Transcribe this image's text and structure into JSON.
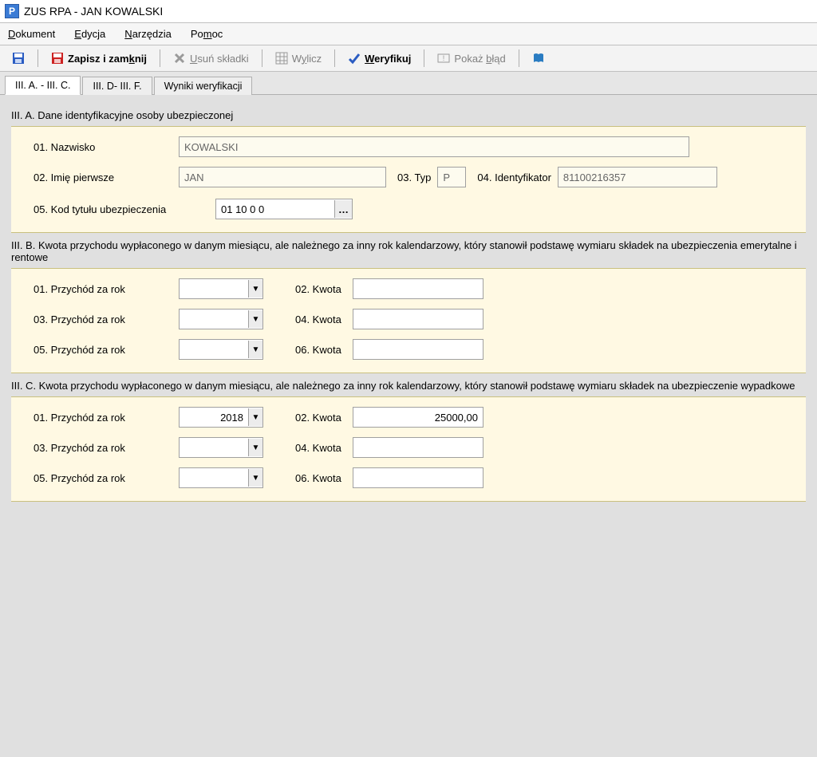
{
  "title": "ZUS RPA - JAN KOWALSKI",
  "menubar": {
    "dokument": "Dokument",
    "edycja": "Edycja",
    "narzedzia": "Narzędzia",
    "pomoc": "Pomoc"
  },
  "toolbar": {
    "save_close": "Zapisz i zamknij",
    "delete": "Usuń składki",
    "calc": "Wylicz",
    "verify": "Weryfikuj",
    "show_error": "Pokaż błąd"
  },
  "tabs": {
    "t1": "III. A. - III. C.",
    "t2": "III. D- III. F.",
    "t3": "Wyniki weryfikacji"
  },
  "sectionA": {
    "heading": "III. A. Dane identyfikacyjne osoby ubezpieczonej",
    "lbl_lastname": "01. Nazwisko",
    "val_lastname": "KOWALSKI",
    "lbl_firstname": "02. Imię pierwsze",
    "val_firstname": "JAN",
    "lbl_type": "03. Typ",
    "val_type": "P",
    "lbl_ident": "04. Identyfikator",
    "val_ident": "81100216357",
    "lbl_code": "05. Kod tytułu ubezpieczenia",
    "val_code": "01 10 0 0"
  },
  "sectionB": {
    "heading": "III. B. Kwota przychodu wypłaconego w danym miesiącu, ale należnego za inny rok kalendarzowy, który  stanowił podstawę wymiaru składek na ubezpieczenia emerytalne i rentowe",
    "lbl_year1": "01. Przychód za  rok",
    "lbl_amt1": "02. Kwota",
    "lbl_year2": "03. Przychód za  rok",
    "lbl_amt2": "04. Kwota",
    "lbl_year3": "05. Przychód za  rok",
    "lbl_amt3": "06. Kwota",
    "val_year1": "",
    "val_amt1": "",
    "val_year2": "",
    "val_amt2": "",
    "val_year3": "",
    "val_amt3": ""
  },
  "sectionC": {
    "heading": "III. C. Kwota przychodu wypłaconego w danym miesiącu, ale należnego za inny rok kalendarzowy, który stanowił podstawę wymiaru składek na ubezpieczenie wypadkowe",
    "lbl_year1": "01. Przychód za  rok",
    "lbl_amt1": "02. Kwota",
    "lbl_year2": "03. Przychód za  rok",
    "lbl_amt2": "04. Kwota",
    "lbl_year3": "05. Przychód za  rok",
    "lbl_amt3": "06. Kwota",
    "val_year1": "2018",
    "val_amt1": "25000,00",
    "val_year2": "",
    "val_amt2": "",
    "val_year3": "",
    "val_amt3": ""
  }
}
